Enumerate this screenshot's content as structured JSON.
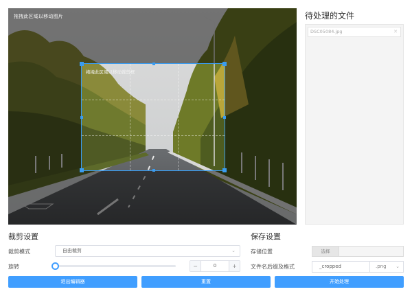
{
  "editor": {
    "drag_hint": "拖拽此区域以移动图片",
    "crop_hint": "拖拽此区域以移动裁剪框"
  },
  "file_panel": {
    "title": "待处理的文件",
    "files": [
      "DSC05084.jpg"
    ]
  },
  "crop_settings": {
    "title": "裁剪设置",
    "mode_label": "裁剪模式",
    "mode_value": "自由裁剪",
    "rotate_label": "旋转",
    "rotate_value": "0",
    "minus": "−",
    "plus": "+"
  },
  "save_settings": {
    "title": "保存设置",
    "location_label": "存储位置",
    "choose_label": "选择",
    "suffix_label": "文件名后缀及格式",
    "suffix_value": "_cropped",
    "format_value": ".png"
  },
  "buttons": {
    "exit": "退出编辑器",
    "reset": "重置",
    "start": "开始处理"
  },
  "colors": {
    "accent": "#409eff",
    "crop_border": "#3a9cf0"
  }
}
